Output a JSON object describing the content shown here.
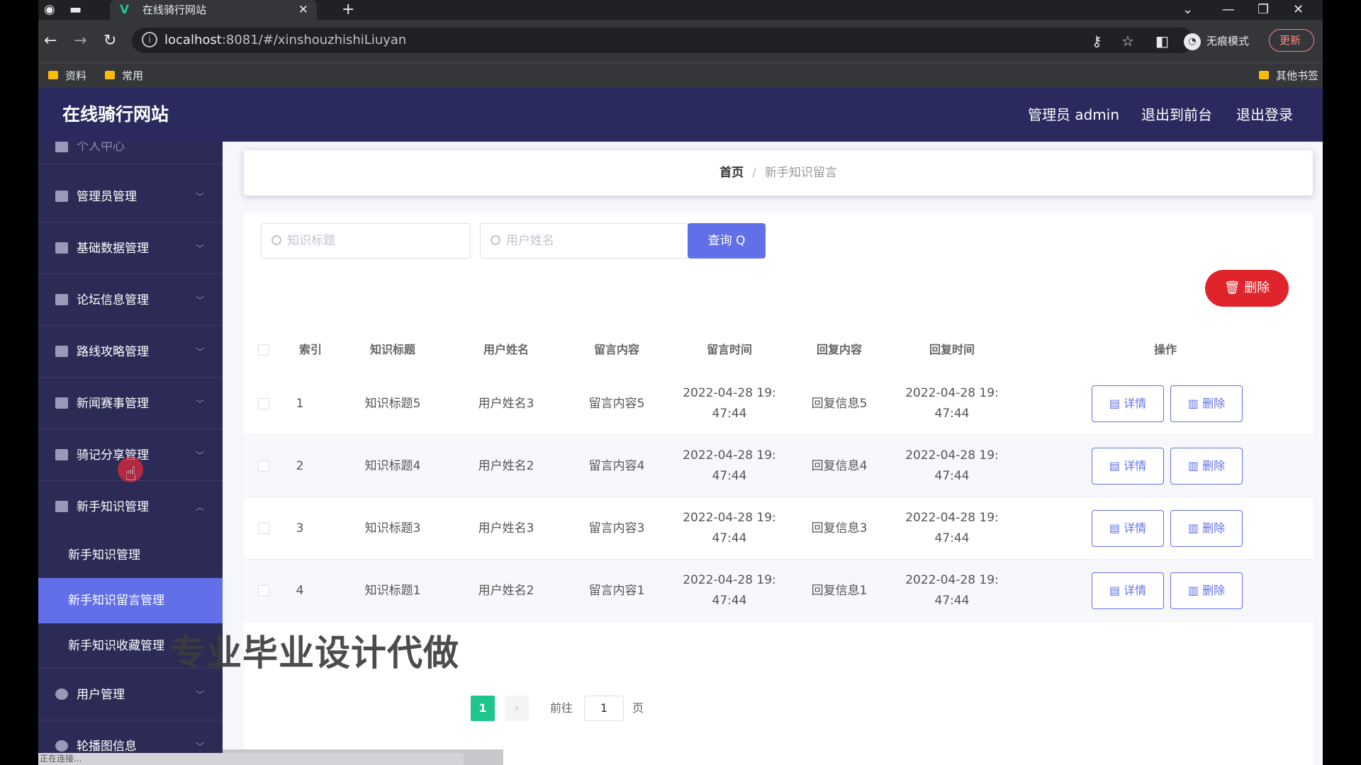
{
  "browser": {
    "tab_title": "在线骑行网站",
    "tab_favicon": "V",
    "url_host": "localhost",
    "url_rest": ":8081/#/xinshouzhishiLiuyan",
    "incognito_label": "无痕模式",
    "update_label": "更新",
    "bookmarks": [
      "资料",
      "常用"
    ],
    "other_bookmarks": "其他书签",
    "status_text": "正在连接..."
  },
  "header": {
    "brand": "在线骑行网站",
    "admin": "管理员 admin",
    "to_front": "退出到前台",
    "logout": "退出登录"
  },
  "sidebar": {
    "personal": "个人中心",
    "items": [
      {
        "label": "管理员管理"
      },
      {
        "label": "基础数据管理"
      },
      {
        "label": "论坛信息管理"
      },
      {
        "label": "路线攻略管理"
      },
      {
        "label": "新闻赛事管理"
      },
      {
        "label": "骑记分享管理"
      },
      {
        "label": "新手知识管理"
      }
    ],
    "sub_items": [
      {
        "label": "新手知识管理"
      },
      {
        "label": "新手知识留言管理"
      },
      {
        "label": "新手知识收藏管理"
      }
    ],
    "after": [
      {
        "label": "用户管理"
      },
      {
        "label": "轮播图信息"
      }
    ]
  },
  "breadcrumb": {
    "home": "首页",
    "sep": "/",
    "current": "新手知识留言"
  },
  "search": {
    "title_placeholder": "知识标题",
    "user_placeholder": "用户姓名",
    "query_label": "查询 Q"
  },
  "bulk_delete_label": "删除",
  "table": {
    "headers": [
      "索引",
      "知识标题",
      "用户姓名",
      "留言内容",
      "留言时间",
      "回复内容",
      "回复时间",
      "操作"
    ],
    "rows": [
      {
        "idx": "1",
        "title": "知识标题5",
        "user": "用户姓名3",
        "content": "留言内容5",
        "time_a": "2022-04-28 19:",
        "time_b": "47:44",
        "reply": "回复信息5",
        "rtime_a": "2022-04-28 19:",
        "rtime_b": "47:44"
      },
      {
        "idx": "2",
        "title": "知识标题4",
        "user": "用户姓名2",
        "content": "留言内容4",
        "time_a": "2022-04-28 19:",
        "time_b": "47:44",
        "reply": "回复信息4",
        "rtime_a": "2022-04-28 19:",
        "rtime_b": "47:44"
      },
      {
        "idx": "3",
        "title": "知识标题3",
        "user": "用户姓名3",
        "content": "留言内容3",
        "time_a": "2022-04-28 19:",
        "time_b": "47:44",
        "reply": "回复信息3",
        "rtime_a": "2022-04-28 19:",
        "rtime_b": "47:44"
      },
      {
        "idx": "4",
        "title": "知识标题1",
        "user": "用户姓名2",
        "content": "留言内容1",
        "time_a": "2022-04-28 19:",
        "time_b": "47:44",
        "reply": "回复信息1",
        "rtime_a": "2022-04-28 19:",
        "rtime_b": "47:44"
      }
    ],
    "detail_label": "详情",
    "delete_label": "删除"
  },
  "pager": {
    "current": "1",
    "next": "›",
    "goto": "前往",
    "goto_value": "1",
    "unit": "页"
  },
  "watermark": "专业毕业设计代做",
  "colors": {
    "header_bg": "#2a2a5e",
    "sidebar_bg": "#2b2b56",
    "accent": "#6170e8",
    "danger": "#e0242c",
    "page_active": "#1ec68d"
  }
}
